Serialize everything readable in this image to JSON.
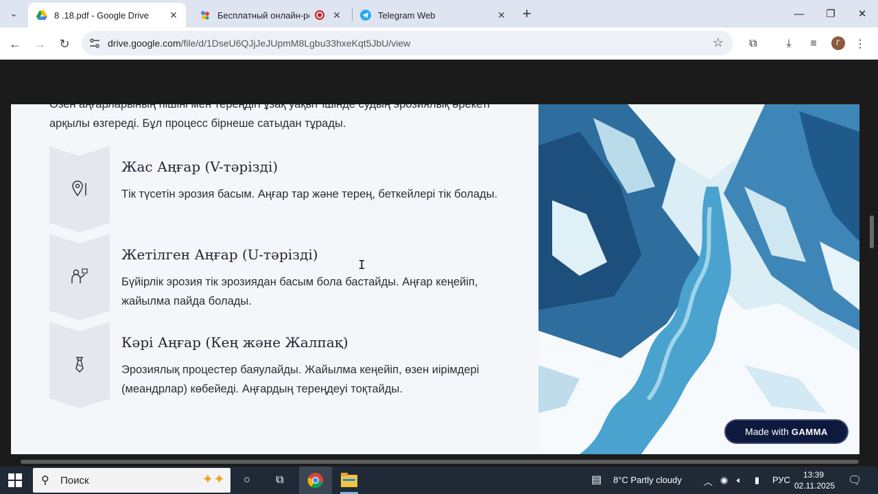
{
  "browser": {
    "tabs": [
      {
        "title": "8 .18.pdf - Google Drive",
        "active": true,
        "favicon": "google-drive-icon"
      },
      {
        "title": "Бесплатный онлайн-рекор",
        "active": false,
        "favicon": "colorful-dots-icon",
        "recording": true
      },
      {
        "title": "Telegram Web",
        "active": false,
        "favicon": "telegram-icon"
      }
    ],
    "url_host": "drive.google.com",
    "url_path": "/file/d/1DseU6QJjJeJUpmM8Lgbu33hxeKqt5JbU/view",
    "profile_initial": "Г"
  },
  "document": {
    "intro": "Өзен аңғарларының пішіні мен тереңдігі ұзақ уақыт ішінде судың эрозиялық әрекеті арқылы өзгереді. Бұл процесс бірнеше сатыдан тұрады.",
    "steps": [
      {
        "title": "Жас Аңғар (V-тәрізді)",
        "text": "Тік түсетін эрозия басым. Аңғар тар және терең, беткейлері тік болады.",
        "icon": "location-pin-icon"
      },
      {
        "title": "Жетілген Аңғар (U-тәрізді)",
        "text": "Бүйірлік эрозия тік эрозиядан басым бола бастайды. Аңғар кеңейіп, жайылма пайда болады.",
        "icon": "person-presenting-icon"
      },
      {
        "title": "Кәрі Аңғар (Кең және Жалпақ)",
        "text": "Эрозиялық процестер баяулайды. Жайылма кеңейіп, өзен иірімдері (меандрлар) көбейеді. Аңғардың тереңдеуі тоқтайды.",
        "icon": "tie-icon"
      }
    ],
    "badge_prefix": "Made with",
    "badge_brand": "GAMMA"
  },
  "taskbar": {
    "search_placeholder": "Поиск",
    "weather": "8°C  Partly cloudy",
    "language": "РУС",
    "time": "13:39",
    "date": "02.11.2025"
  }
}
